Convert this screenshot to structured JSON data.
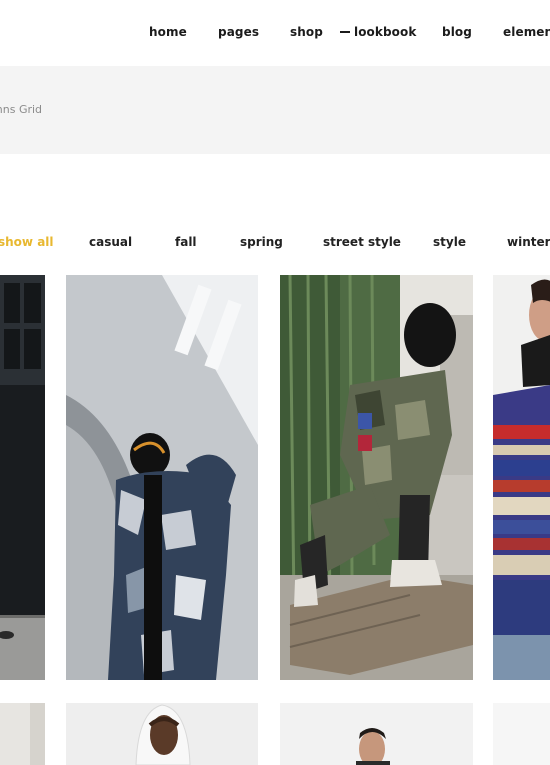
{
  "nav": {
    "items": [
      {
        "label": "home"
      },
      {
        "label": "pages"
      },
      {
        "label": "shop"
      },
      {
        "label": "lookbook"
      },
      {
        "label": "blog"
      },
      {
        "label": "element"
      }
    ]
  },
  "header": {
    "title": "lumns Grid"
  },
  "filters": [
    {
      "label": "show all"
    },
    {
      "label": "casual"
    },
    {
      "label": "fall"
    },
    {
      "label": "spring"
    },
    {
      "label": "street style"
    },
    {
      "label": "style"
    },
    {
      "label": "winter"
    }
  ],
  "colors": {
    "accent": "#e8b830",
    "band": "#f4f4f4",
    "text": "#1b1b1b"
  }
}
